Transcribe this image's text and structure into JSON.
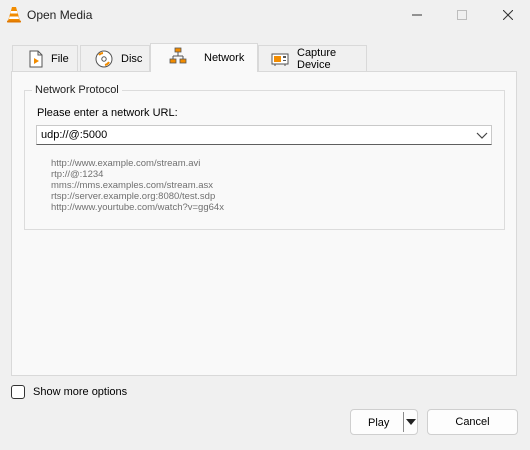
{
  "window": {
    "title": "Open Media",
    "app_icon": "vlc-cone-icon",
    "controls": [
      "minimize-icon",
      "maximize-icon",
      "close-icon"
    ]
  },
  "tabs": [
    {
      "label": "File",
      "icon": "file-icon",
      "active": false
    },
    {
      "label": "Disc",
      "icon": "disc-icon",
      "active": false
    },
    {
      "label": "Network",
      "icon": "network-icon",
      "active": true
    },
    {
      "label": "Capture Device",
      "icon": "capture-device-icon",
      "active": false
    }
  ],
  "network": {
    "group_title": "Network Protocol",
    "url_label": "Please enter a network URL:",
    "url_value": "udp://@:5000",
    "examples": [
      "http://www.example.com/stream.avi",
      "rtp://@:1234",
      "mms://mms.examples.com/stream.asx",
      "rtsp://server.example.org:8080/test.sdp",
      "http://www.yourtube.com/watch?v=gg64x"
    ]
  },
  "options": {
    "show_more_label": "Show more options",
    "show_more_checked": false
  },
  "buttons": {
    "play_label": "Play",
    "cancel_label": "Cancel"
  },
  "colors": {
    "vlc_orange": "#f28c00",
    "window_bg": "#f0f0f0",
    "panel_bg": "#f9f9f9",
    "hint_text": "#707070"
  }
}
